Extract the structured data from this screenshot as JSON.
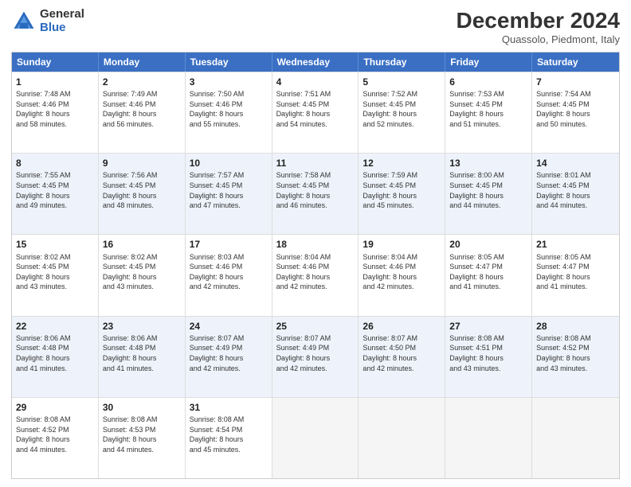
{
  "logo": {
    "general": "General",
    "blue": "Blue"
  },
  "title": "December 2024",
  "location": "Quassolo, Piedmont, Italy",
  "header_days": [
    "Sunday",
    "Monday",
    "Tuesday",
    "Wednesday",
    "Thursday",
    "Friday",
    "Saturday"
  ],
  "rows": [
    [
      {
        "day": "1",
        "lines": [
          "Sunrise: 7:48 AM",
          "Sunset: 4:46 PM",
          "Daylight: 8 hours",
          "and 58 minutes."
        ]
      },
      {
        "day": "2",
        "lines": [
          "Sunrise: 7:49 AM",
          "Sunset: 4:46 PM",
          "Daylight: 8 hours",
          "and 56 minutes."
        ]
      },
      {
        "day": "3",
        "lines": [
          "Sunrise: 7:50 AM",
          "Sunset: 4:46 PM",
          "Daylight: 8 hours",
          "and 55 minutes."
        ]
      },
      {
        "day": "4",
        "lines": [
          "Sunrise: 7:51 AM",
          "Sunset: 4:45 PM",
          "Daylight: 8 hours",
          "and 54 minutes."
        ]
      },
      {
        "day": "5",
        "lines": [
          "Sunrise: 7:52 AM",
          "Sunset: 4:45 PM",
          "Daylight: 8 hours",
          "and 52 minutes."
        ]
      },
      {
        "day": "6",
        "lines": [
          "Sunrise: 7:53 AM",
          "Sunset: 4:45 PM",
          "Daylight: 8 hours",
          "and 51 minutes."
        ]
      },
      {
        "day": "7",
        "lines": [
          "Sunrise: 7:54 AM",
          "Sunset: 4:45 PM",
          "Daylight: 8 hours",
          "and 50 minutes."
        ]
      }
    ],
    [
      {
        "day": "8",
        "lines": [
          "Sunrise: 7:55 AM",
          "Sunset: 4:45 PM",
          "Daylight: 8 hours",
          "and 49 minutes."
        ]
      },
      {
        "day": "9",
        "lines": [
          "Sunrise: 7:56 AM",
          "Sunset: 4:45 PM",
          "Daylight: 8 hours",
          "and 48 minutes."
        ]
      },
      {
        "day": "10",
        "lines": [
          "Sunrise: 7:57 AM",
          "Sunset: 4:45 PM",
          "Daylight: 8 hours",
          "and 47 minutes."
        ]
      },
      {
        "day": "11",
        "lines": [
          "Sunrise: 7:58 AM",
          "Sunset: 4:45 PM",
          "Daylight: 8 hours",
          "and 46 minutes."
        ]
      },
      {
        "day": "12",
        "lines": [
          "Sunrise: 7:59 AM",
          "Sunset: 4:45 PM",
          "Daylight: 8 hours",
          "and 45 minutes."
        ]
      },
      {
        "day": "13",
        "lines": [
          "Sunrise: 8:00 AM",
          "Sunset: 4:45 PM",
          "Daylight: 8 hours",
          "and 44 minutes."
        ]
      },
      {
        "day": "14",
        "lines": [
          "Sunrise: 8:01 AM",
          "Sunset: 4:45 PM",
          "Daylight: 8 hours",
          "and 44 minutes."
        ]
      }
    ],
    [
      {
        "day": "15",
        "lines": [
          "Sunrise: 8:02 AM",
          "Sunset: 4:45 PM",
          "Daylight: 8 hours",
          "and 43 minutes."
        ]
      },
      {
        "day": "16",
        "lines": [
          "Sunrise: 8:02 AM",
          "Sunset: 4:45 PM",
          "Daylight: 8 hours",
          "and 43 minutes."
        ]
      },
      {
        "day": "17",
        "lines": [
          "Sunrise: 8:03 AM",
          "Sunset: 4:46 PM",
          "Daylight: 8 hours",
          "and 42 minutes."
        ]
      },
      {
        "day": "18",
        "lines": [
          "Sunrise: 8:04 AM",
          "Sunset: 4:46 PM",
          "Daylight: 8 hours",
          "and 42 minutes."
        ]
      },
      {
        "day": "19",
        "lines": [
          "Sunrise: 8:04 AM",
          "Sunset: 4:46 PM",
          "Daylight: 8 hours",
          "and 42 minutes."
        ]
      },
      {
        "day": "20",
        "lines": [
          "Sunrise: 8:05 AM",
          "Sunset: 4:47 PM",
          "Daylight: 8 hours",
          "and 41 minutes."
        ]
      },
      {
        "day": "21",
        "lines": [
          "Sunrise: 8:05 AM",
          "Sunset: 4:47 PM",
          "Daylight: 8 hours",
          "and 41 minutes."
        ]
      }
    ],
    [
      {
        "day": "22",
        "lines": [
          "Sunrise: 8:06 AM",
          "Sunset: 4:48 PM",
          "Daylight: 8 hours",
          "and 41 minutes."
        ]
      },
      {
        "day": "23",
        "lines": [
          "Sunrise: 8:06 AM",
          "Sunset: 4:48 PM",
          "Daylight: 8 hours",
          "and 41 minutes."
        ]
      },
      {
        "day": "24",
        "lines": [
          "Sunrise: 8:07 AM",
          "Sunset: 4:49 PM",
          "Daylight: 8 hours",
          "and 42 minutes."
        ]
      },
      {
        "day": "25",
        "lines": [
          "Sunrise: 8:07 AM",
          "Sunset: 4:49 PM",
          "Daylight: 8 hours",
          "and 42 minutes."
        ]
      },
      {
        "day": "26",
        "lines": [
          "Sunrise: 8:07 AM",
          "Sunset: 4:50 PM",
          "Daylight: 8 hours",
          "and 42 minutes."
        ]
      },
      {
        "day": "27",
        "lines": [
          "Sunrise: 8:08 AM",
          "Sunset: 4:51 PM",
          "Daylight: 8 hours",
          "and 43 minutes."
        ]
      },
      {
        "day": "28",
        "lines": [
          "Sunrise: 8:08 AM",
          "Sunset: 4:52 PM",
          "Daylight: 8 hours",
          "and 43 minutes."
        ]
      }
    ],
    [
      {
        "day": "29",
        "lines": [
          "Sunrise: 8:08 AM",
          "Sunset: 4:52 PM",
          "Daylight: 8 hours",
          "and 44 minutes."
        ]
      },
      {
        "day": "30",
        "lines": [
          "Sunrise: 8:08 AM",
          "Sunset: 4:53 PM",
          "Daylight: 8 hours",
          "and 44 minutes."
        ]
      },
      {
        "day": "31",
        "lines": [
          "Sunrise: 8:08 AM",
          "Sunset: 4:54 PM",
          "Daylight: 8 hours",
          "and 45 minutes."
        ]
      },
      {
        "day": "",
        "lines": []
      },
      {
        "day": "",
        "lines": []
      },
      {
        "day": "",
        "lines": []
      },
      {
        "day": "",
        "lines": []
      }
    ]
  ],
  "row_alt": [
    false,
    true,
    false,
    true,
    false
  ]
}
